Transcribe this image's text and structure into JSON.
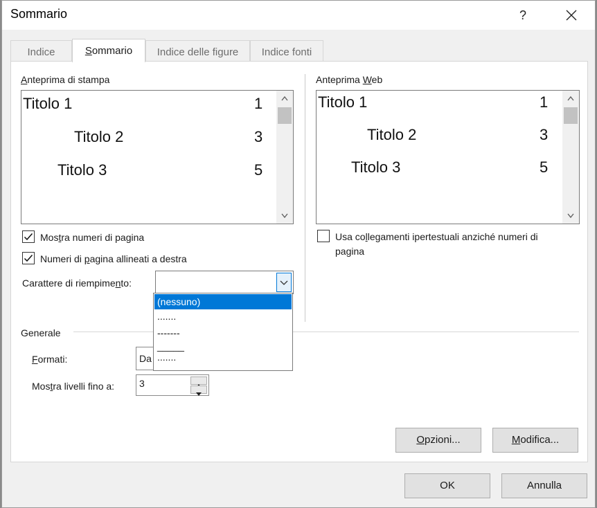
{
  "window": {
    "title": "Sommario",
    "help_glyph": "?",
    "close_icon": "close-icon"
  },
  "tabs": [
    {
      "label": "Indice",
      "active": false
    },
    {
      "label_pre": "",
      "label_ul": "S",
      "label_post": "ommario",
      "active": true
    },
    {
      "label": "Indice delle figure",
      "active": false
    },
    {
      "label": "Indice fonti",
      "active": false
    }
  ],
  "print_preview": {
    "label_ul": "A",
    "label_post": "nteprima di stampa",
    "entries": [
      {
        "text": "Titolo 1",
        "page": "1"
      },
      {
        "text": "Titolo 2",
        "page": "3"
      },
      {
        "text": "Titolo 3",
        "page": "5"
      }
    ]
  },
  "web_preview": {
    "label_pre": "Anteprima ",
    "label_ul": "W",
    "label_post": "eb",
    "entries": [
      {
        "text": "Titolo 1",
        "page": "1"
      },
      {
        "text": "Titolo 2",
        "page": "3"
      },
      {
        "text": "Titolo 3",
        "page": "5"
      }
    ]
  },
  "options": {
    "show_page_numbers": {
      "pre": "Mos",
      "ul": "t",
      "post": "ra numeri di pagina",
      "checked": true
    },
    "right_align": {
      "pre": "Numeri di ",
      "ul": "p",
      "post": "agina allineati a destra",
      "checked": true
    },
    "hyperlinks": {
      "pre": "Usa co",
      "ul": "l",
      "post": "legamenti ipertestuali anziché numeri di",
      "line2": "pagina",
      "checked": false
    },
    "tab_leader_label": {
      "pre": "Carattere di riempime",
      "ul": "n",
      "post": "to:"
    }
  },
  "tab_leader_dropdown": {
    "items": [
      "(nessuno)",
      ".......",
      "-------",
      "_____",
      "......."
    ],
    "selected_index": 0
  },
  "general": {
    "heading": "Generale",
    "formats_label": {
      "ul": "F",
      "post": "ormati:"
    },
    "formats_value": "Da",
    "levels_label": {
      "pre": "Mostra livelli fino a",
      "ul": "",
      "post": ":"
    },
    "levels_label_full": {
      "pre": "Mos",
      "ul": "t",
      "post": "ra livelli fino a:"
    },
    "levels_value": "3"
  },
  "buttons": {
    "options": {
      "ul": "O",
      "post": "pzioni..."
    },
    "modify": {
      "ul": "M",
      "post": "odifica..."
    },
    "ok": "OK",
    "cancel": "Annulla"
  },
  "colors": {
    "accent": "#0078d7",
    "dialog_bg": "#f0f0f0"
  }
}
